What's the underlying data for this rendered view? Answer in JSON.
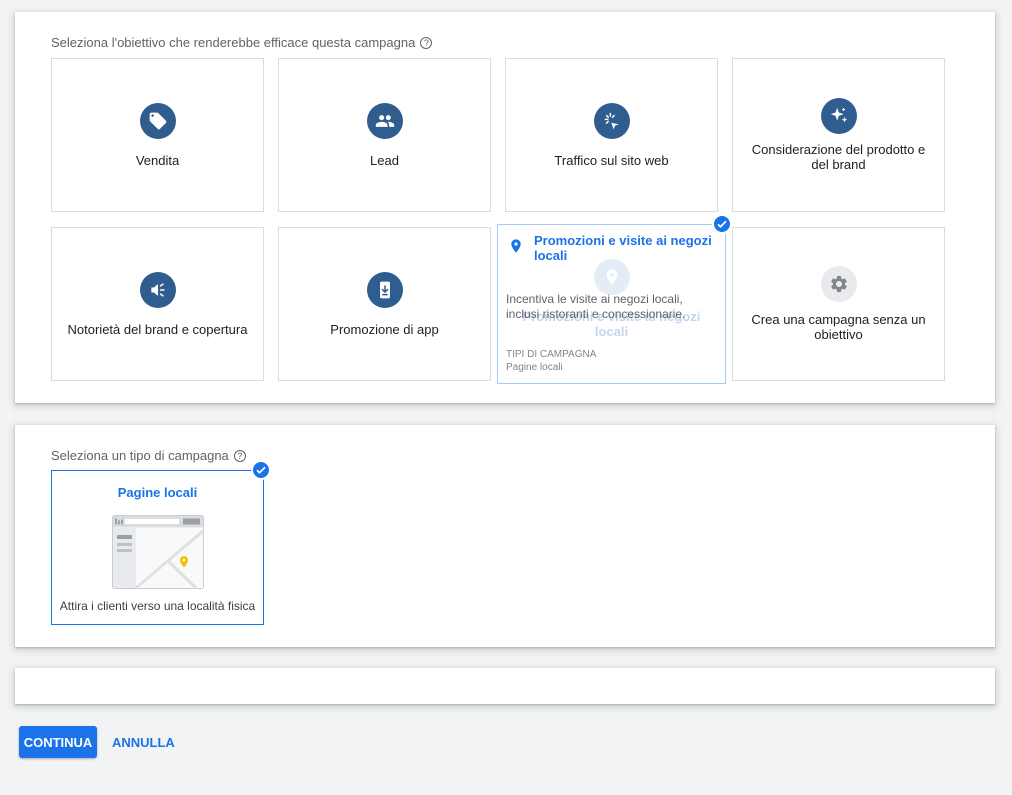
{
  "goal_section": {
    "title": "Seleziona l'obiettivo che renderebbe efficace questa campagna",
    "help_icon": "help-circle-icon",
    "goals": [
      {
        "label": "Vendita",
        "icon": "tag-icon"
      },
      {
        "label": "Lead",
        "icon": "people-icon"
      },
      {
        "label": "Traffico sul sito web",
        "icon": "cursor-click-icon"
      },
      {
        "label": "Considerazione del prodotto e del brand",
        "icon": "sparkle-icon"
      },
      {
        "label": "Notorietà del brand e copertura",
        "icon": "megaphone-icon"
      },
      {
        "label": "Promozione di app",
        "icon": "mobile-download-icon"
      },
      {
        "label": "Promozioni e visite ai negozi locali",
        "icon": "location-pin-icon"
      },
      {
        "label": "Crea una campagna senza un obiettivo",
        "icon": "gear-icon"
      }
    ],
    "hover_card": {
      "title": "Promozioni e visite ai negozi locali",
      "description": "Incentiva le visite ai negozi locali, inclusi ristoranti e concessionarie.",
      "campaign_types_heading": "TIPI DI CAMPAGNA",
      "campaign_types_value": "Pagine locali"
    }
  },
  "type_section": {
    "title": "Seleziona un tipo di campagna",
    "types": [
      {
        "label": "Pagine locali",
        "description": "Attira i clienti verso una località fisica",
        "selected": true
      }
    ]
  },
  "actions": {
    "continue_label": "CONTINUA",
    "cancel_label": "ANNULLA"
  },
  "colors": {
    "accent": "#1a73e8",
    "icon_bg": "#2f5d8f",
    "page_bg": "#f1f3f4"
  }
}
